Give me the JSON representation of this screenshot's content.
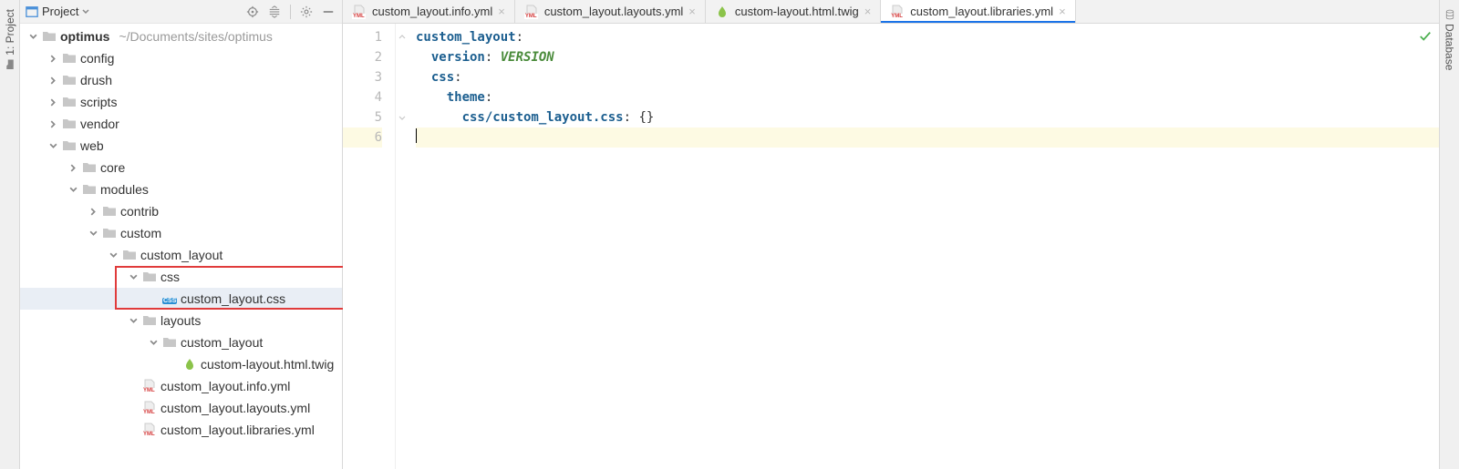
{
  "leftstrip": {
    "project_label": "1: Project"
  },
  "rightstrip": {
    "database_label": "Database"
  },
  "project_header": {
    "title": "Project"
  },
  "tree": [
    {
      "depth": 0,
      "arrow": "down",
      "icon": "folder",
      "label": "optimus",
      "bold": true,
      "path": "~/Documents/sites/optimus"
    },
    {
      "depth": 1,
      "arrow": "right",
      "icon": "folder",
      "label": "config"
    },
    {
      "depth": 1,
      "arrow": "right",
      "icon": "folder",
      "label": "drush"
    },
    {
      "depth": 1,
      "arrow": "right",
      "icon": "folder",
      "label": "scripts"
    },
    {
      "depth": 1,
      "arrow": "right",
      "icon": "folder",
      "label": "vendor"
    },
    {
      "depth": 1,
      "arrow": "down",
      "icon": "folder",
      "label": "web"
    },
    {
      "depth": 2,
      "arrow": "right",
      "icon": "folder",
      "label": "core"
    },
    {
      "depth": 2,
      "arrow": "down",
      "icon": "folder",
      "label": "modules"
    },
    {
      "depth": 3,
      "arrow": "right",
      "icon": "folder",
      "label": "contrib"
    },
    {
      "depth": 3,
      "arrow": "down",
      "icon": "folder",
      "label": "custom"
    },
    {
      "depth": 4,
      "arrow": "down",
      "icon": "folder",
      "label": "custom_layout"
    },
    {
      "depth": 5,
      "arrow": "down",
      "icon": "folder",
      "label": "css",
      "highlight": true
    },
    {
      "depth": 6,
      "arrow": "none",
      "icon": "css",
      "label": "custom_layout.css",
      "selected": true,
      "highlight": true
    },
    {
      "depth": 5,
      "arrow": "down",
      "icon": "folder",
      "label": "layouts"
    },
    {
      "depth": 6,
      "arrow": "down",
      "icon": "folder",
      "label": "custom_layout"
    },
    {
      "depth": 7,
      "arrow": "none",
      "icon": "twig",
      "label": "custom-layout.html.twig"
    },
    {
      "depth": 5,
      "arrow": "none",
      "icon": "yml",
      "label": "custom_layout.info.yml"
    },
    {
      "depth": 5,
      "arrow": "none",
      "icon": "yml",
      "label": "custom_layout.layouts.yml"
    },
    {
      "depth": 5,
      "arrow": "none",
      "icon": "yml",
      "label": "custom_layout.libraries.yml"
    }
  ],
  "tabs": [
    {
      "icon": "yml",
      "label": "custom_layout.info.yml",
      "active": false
    },
    {
      "icon": "yml",
      "label": "custom_layout.layouts.yml",
      "active": false
    },
    {
      "icon": "twig",
      "label": "custom-layout.html.twig",
      "active": false
    },
    {
      "icon": "yml",
      "label": "custom_layout.libraries.yml",
      "active": true
    }
  ],
  "editor": {
    "lines": [
      {
        "n": 1,
        "segments": [
          {
            "t": "custom_layout",
            "c": "tok-key"
          },
          {
            "t": ":",
            "c": "tok-plain"
          }
        ]
      },
      {
        "n": 2,
        "segments": [
          {
            "t": "  ",
            "c": ""
          },
          {
            "t": "version",
            "c": "tok-key"
          },
          {
            "t": ": ",
            "c": "tok-plain"
          },
          {
            "t": "VERSION",
            "c": "tok-green"
          }
        ]
      },
      {
        "n": 3,
        "segments": [
          {
            "t": "  ",
            "c": ""
          },
          {
            "t": "css",
            "c": "tok-key"
          },
          {
            "t": ":",
            "c": "tok-plain"
          }
        ]
      },
      {
        "n": 4,
        "segments": [
          {
            "t": "    ",
            "c": ""
          },
          {
            "t": "theme",
            "c": "tok-key"
          },
          {
            "t": ":",
            "c": "tok-plain"
          }
        ]
      },
      {
        "n": 5,
        "segments": [
          {
            "t": "      ",
            "c": ""
          },
          {
            "t": "css/custom_layout.css",
            "c": "tok-key"
          },
          {
            "t": ": {}",
            "c": "tok-plain"
          }
        ]
      },
      {
        "n": 6,
        "segments": [],
        "current": true,
        "cursor": true
      }
    ]
  }
}
